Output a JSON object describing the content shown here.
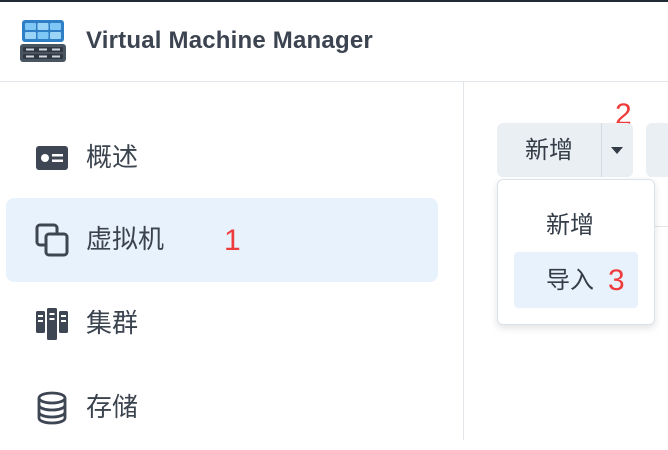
{
  "app": {
    "title": "Virtual Machine Manager",
    "icon": "virtual-machine-manager-app-icon"
  },
  "sidebar": {
    "items": [
      {
        "label": "概述",
        "icon": "overview-card-icon",
        "active": false
      },
      {
        "label": "虚拟机",
        "icon": "virtual-machine-copy-icon",
        "active": true
      },
      {
        "label": "集群",
        "icon": "cluster-icon",
        "active": false
      },
      {
        "label": "存储",
        "icon": "storage-database-icon",
        "active": false
      }
    ]
  },
  "toolbar": {
    "new_label": "新增",
    "dropdown_caret_icon": "caret-down-icon"
  },
  "dropdown_menu": {
    "items": [
      {
        "label": "新增"
      },
      {
        "label": "导入",
        "hovered": true
      }
    ]
  },
  "annotations": {
    "step1": "1",
    "step2": "2",
    "step3": "3"
  },
  "colors": {
    "accent_bg": "#e8f2fc",
    "annotation": "#ee3b3b",
    "button_bg": "#eaeff4",
    "text": "#333c47"
  }
}
